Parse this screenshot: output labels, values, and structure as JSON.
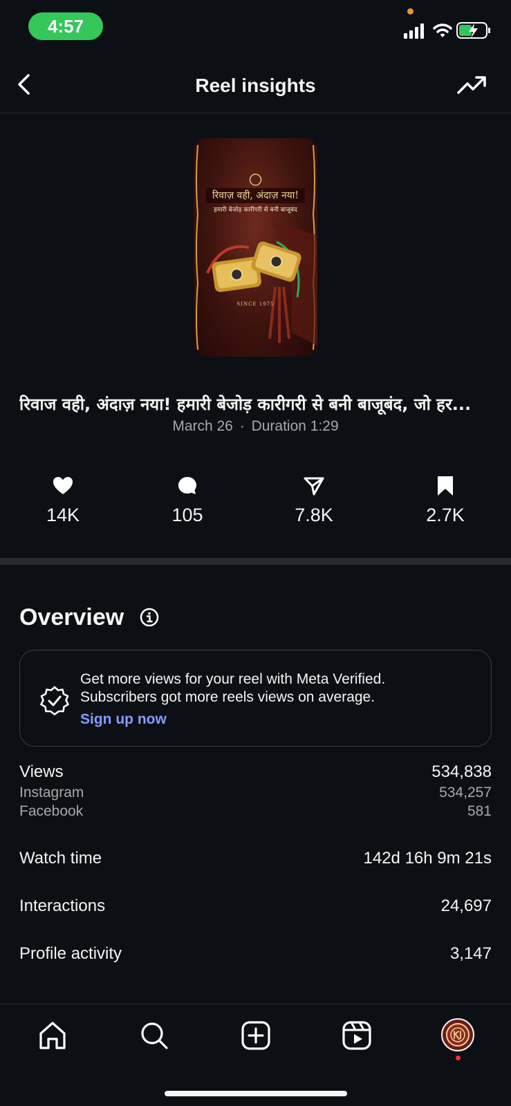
{
  "status_bar": {
    "time": "4:57",
    "icons": [
      "cellular-signal-icon",
      "wifi-icon",
      "battery-charging-icon"
    ]
  },
  "header": {
    "title": "Reel insights",
    "back_icon": "chevron-left-icon",
    "trend_icon": "trending-up-icon"
  },
  "reel": {
    "thumbnail": {
      "headline": "रिवाज़ वही, अंदाज़ नया!",
      "subline": "हमारी बेजोड़ कारीगरी से बनी बाजूबंद",
      "since": "SINCE 1975"
    },
    "caption": "रिवाज वही, अंदाज़ नया! हमारी बेजोड़ कारीगरी से बनी बाजूबंद, जो हर...",
    "date": "March 26",
    "separator": "·",
    "duration": "Duration 1:29"
  },
  "stats": [
    {
      "icon": "heart-icon",
      "value": "14K"
    },
    {
      "icon": "comment-icon",
      "value": "105"
    },
    {
      "icon": "share-icon",
      "value": "7.8K"
    },
    {
      "icon": "bookmark-icon",
      "value": "2.7K"
    }
  ],
  "overview": {
    "title": "Overview",
    "promo": {
      "line1": "Get more views for your reel with Meta Verified.",
      "line2": "Subscribers got more reels views on average.",
      "link": "Sign up now"
    },
    "views": {
      "label": "Views",
      "value": "534,838"
    },
    "instagram": {
      "label": "Instagram",
      "value": "534,257"
    },
    "facebook": {
      "label": "Facebook",
      "value": "581"
    },
    "watch_time": {
      "label": "Watch time",
      "value": "142d 16h 9m 21s"
    },
    "interactions": {
      "label": "Interactions",
      "value": "24,697"
    },
    "profile_activity": {
      "label": "Profile activity",
      "value": "3,147"
    }
  },
  "tab_bar": {
    "tabs": [
      "home-icon",
      "search-icon",
      "create-icon",
      "reels-icon",
      "profile-avatar"
    ]
  },
  "colors": {
    "background": "#0c1014",
    "link": "#859dff",
    "time_pill": "#34c759",
    "muted_text": "#a8a8a8"
  }
}
